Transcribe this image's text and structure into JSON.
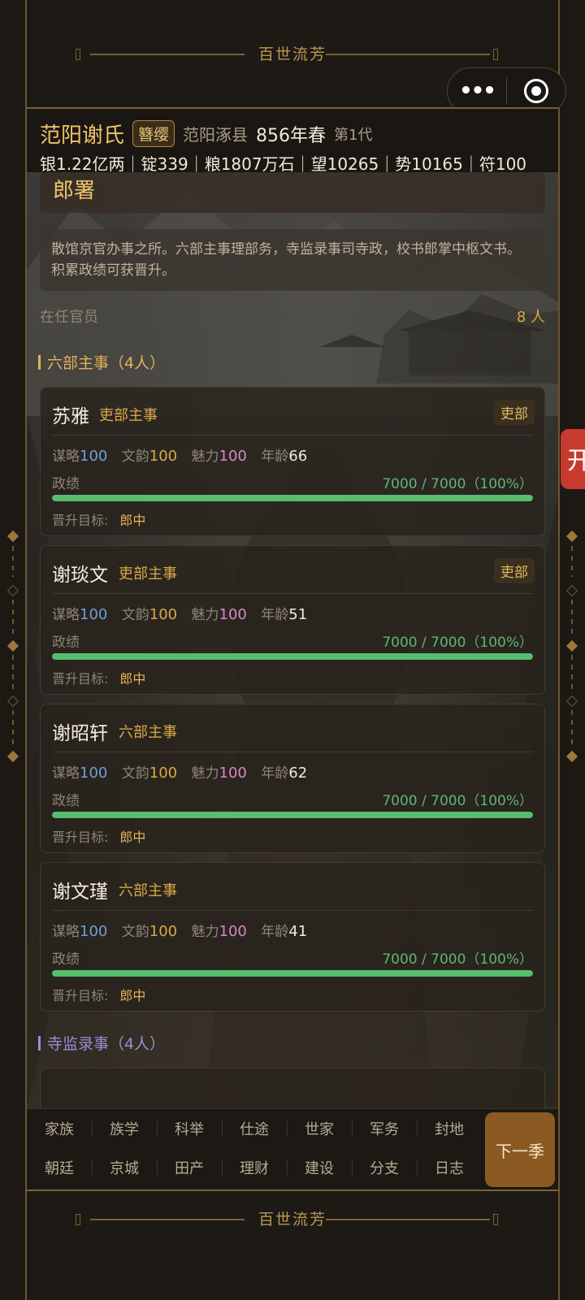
{
  "top_banner": {
    "title": "百世流芳"
  },
  "bottom_banner": {
    "title": "百世流芳"
  },
  "capsule": {
    "menu_icon": "more-dots-icon",
    "close_icon": "target-icon",
    "menu_glyph": "•••"
  },
  "header": {
    "clan_name": "范阳谢氏",
    "rank": "簪缨",
    "location": "范阳涿县",
    "year": "856年春",
    "generation": "第1代",
    "resources": "银1.22亿两｜锭339｜粮1807万石｜望10265｜势10165｜符100"
  },
  "section": {
    "title": "郎署",
    "description": "散馆京官办事之所。六部主事理部务，寺监录事司寺政，校书郎掌中枢文书。积累政绩可获晋升。",
    "staff_label": "在任官员",
    "staff_count": "8 人"
  },
  "labels": {
    "strategy": "谋略",
    "literary": "文韵",
    "charm": "魅力",
    "age": "年龄",
    "merit": "政绩",
    "promotion": "晋升目标:"
  },
  "groups": [
    {
      "title": "六部主事（4人）",
      "officials": [
        {
          "name": "苏雅",
          "post": "吏部主事",
          "dept": "吏部",
          "strategy": "100",
          "literary": "100",
          "charm": "100",
          "age": "66",
          "merit": "7000 / 7000（100%）",
          "merit_fraction": 1.0,
          "promotion_target": "郎中"
        },
        {
          "name": "谢琰文",
          "post": "吏部主事",
          "dept": "吏部",
          "strategy": "100",
          "literary": "100",
          "charm": "100",
          "age": "51",
          "merit": "7000 / 7000（100%）",
          "merit_fraction": 1.0,
          "promotion_target": "郎中"
        },
        {
          "name": "谢昭轩",
          "post": "六部主事",
          "dept": "",
          "strategy": "100",
          "literary": "100",
          "charm": "100",
          "age": "62",
          "merit": "7000 / 7000（100%）",
          "merit_fraction": 1.0,
          "promotion_target": "郎中"
        },
        {
          "name": "谢文瑾",
          "post": "六部主事",
          "dept": "",
          "strategy": "100",
          "literary": "100",
          "charm": "100",
          "age": "41",
          "merit": "7000 / 7000（100%）",
          "merit_fraction": 1.0,
          "promotion_target": "郎中"
        }
      ]
    },
    {
      "title": "寺监录事（4人）"
    }
  ],
  "nav": {
    "row1": [
      "家族",
      "族学",
      "科举",
      "仕途",
      "世家",
      "军务",
      "封地"
    ],
    "row2": [
      "朝廷",
      "京城",
      "田产",
      "理财",
      "建设",
      "分支",
      "日志"
    ],
    "next_button": "下一季"
  },
  "side_tab": {
    "label": "开"
  },
  "colors": {
    "accent_gold": "#efc46b",
    "merit_green": "#56be6e",
    "strategy_blue": "#6f9fd8",
    "charm_pink": "#d887c8",
    "next_button_bg": "#8a5a22",
    "side_tab_red": "#c73b2e"
  }
}
